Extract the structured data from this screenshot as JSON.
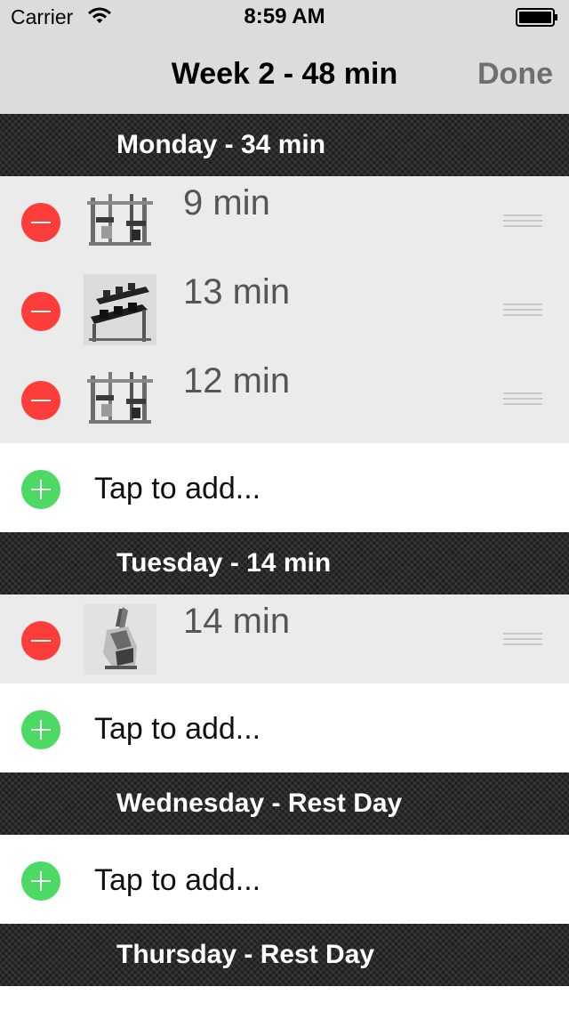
{
  "status_bar": {
    "carrier": "Carrier",
    "time": "8:59 AM",
    "wifi_icon": "wifi-icon",
    "battery_icon": "battery-full-icon"
  },
  "nav": {
    "title": "Week 2 - 48 min",
    "done_label": "Done"
  },
  "colors": {
    "delete": "#fc3d39",
    "add": "#4cd964",
    "workout_row_bg": "#ebebeb",
    "header_bg": "#2a2a2a"
  },
  "days": [
    {
      "header": "Monday - 34 min",
      "workouts": [
        {
          "duration": "9 min",
          "icon": "squat-rack-icon"
        },
        {
          "duration": "13 min",
          "icon": "dumbbell-rack-icon"
        },
        {
          "duration": "12 min",
          "icon": "squat-rack-icon"
        }
      ],
      "add_label": "Tap to add..."
    },
    {
      "header": "Tuesday - 14 min",
      "workouts": [
        {
          "duration": "14 min",
          "icon": "elliptical-machine-icon"
        }
      ],
      "add_label": "Tap to add..."
    },
    {
      "header": "Wednesday - Rest Day",
      "workouts": [],
      "add_label": "Tap to add..."
    },
    {
      "header": "Thursday - Rest Day"
    }
  ]
}
